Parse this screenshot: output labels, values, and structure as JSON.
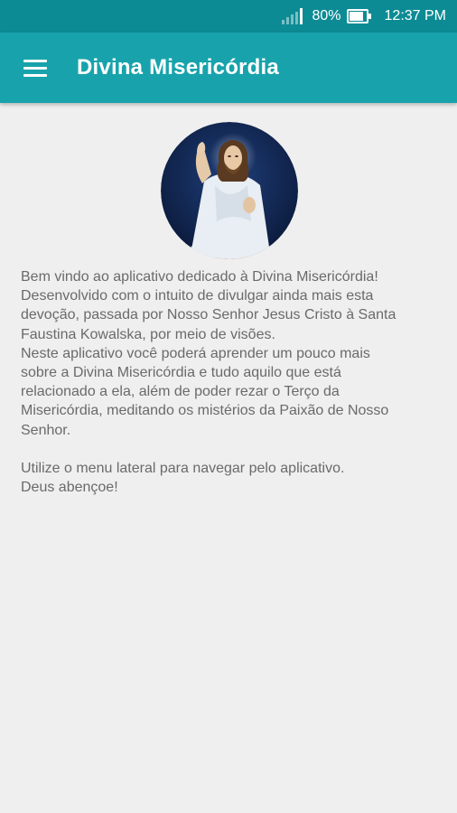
{
  "status_bar": {
    "battery": "80%",
    "time": "12:37 PM"
  },
  "app_bar": {
    "title": "Divina Misericórdia"
  },
  "image": {
    "icon": "divine-mercy-image"
  },
  "content": {
    "paragraph1": "Bem vindo ao aplicativo dedicado à Divina Misericórdia!\nDesenvolvido com o intuito de divulgar ainda mais esta\ndevoção, passada por Nosso Senhor Jesus Cristo à Santa\nFaustina Kowalska, por meio de visões.\nNeste aplicativo você poderá aprender um pouco mais\nsobre a Divina Misericórdia e tudo aquilo que está\nrelacionado a ela, além de poder rezar o Terço da\nMisericórdia, meditando os mistérios da Paixão de Nosso\nSenhor.",
    "paragraph2": "Utilize o menu lateral para navegar pelo aplicativo.\nDeus abençoe!"
  },
  "colors": {
    "status_bar": "#0d8b94",
    "app_bar": "#18a3ac",
    "background": "#efefef",
    "text": "#6a6a6a"
  }
}
